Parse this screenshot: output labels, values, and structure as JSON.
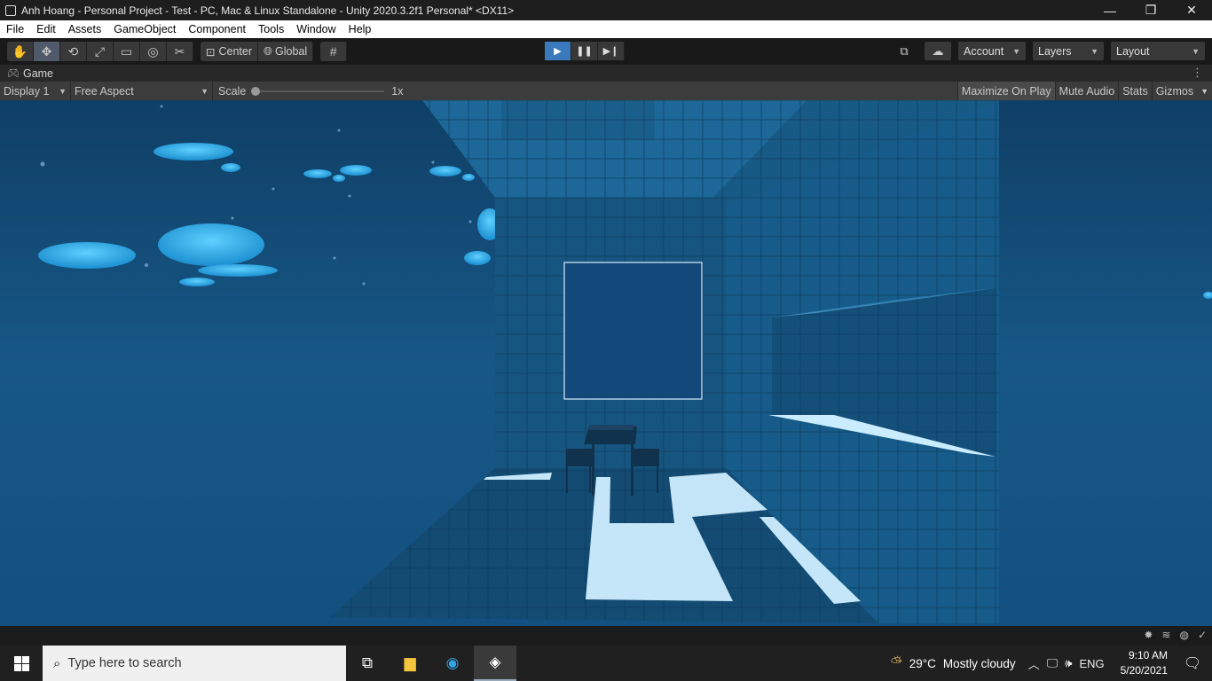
{
  "window": {
    "title": "Anh Hoang - Personal Project - Test - PC, Mac & Linux Standalone - Unity 2020.3.2f1 Personal* <DX11>",
    "minimize": "—",
    "maximize": "❐",
    "close": "✕"
  },
  "menu": [
    "File",
    "Edit",
    "Assets",
    "GameObject",
    "Component",
    "Tools",
    "Window",
    "Help"
  ],
  "toolbar": {
    "pivot_mode": "Center",
    "pivot_rotation": "Global",
    "account": "Account",
    "layers": "Layers",
    "layout": "Layout"
  },
  "game_tab": {
    "label": "Game"
  },
  "game_bar": {
    "display": "Display 1",
    "aspect": "Free Aspect",
    "scale_label": "Scale",
    "scale_value": "1x",
    "maximize_on_play": "Maximize On Play",
    "mute_audio": "Mute Audio",
    "stats": "Stats",
    "gizmos": "Gizmos"
  },
  "taskbar": {
    "search_placeholder": "Type here to search",
    "temperature": "29°C",
    "weather": "Mostly cloudy",
    "language": "ENG",
    "time": "9:10 AM",
    "date": "5/20/2021"
  },
  "colors": {
    "play_active": "#3a79bb",
    "sky": "#124a74",
    "room": "#1a5c86"
  }
}
